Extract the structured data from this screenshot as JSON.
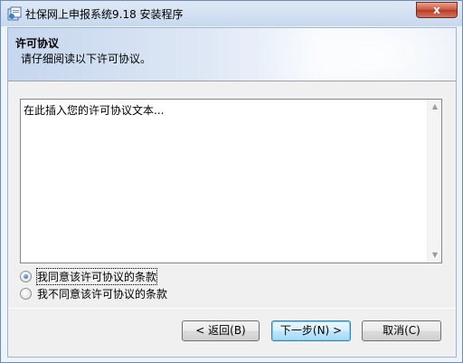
{
  "window": {
    "title": "社保网上申报系统9.18 安装程序",
    "close_label": "x"
  },
  "header": {
    "title": "许可协议",
    "subtitle": "请仔细阅读以下许可协议。"
  },
  "license": {
    "text": "在此插入您的许可协议文本..."
  },
  "scrollbar": {
    "up_icon": "▲",
    "down_icon": "▼"
  },
  "options": {
    "accept_label": "我同意该许可协议的条款",
    "decline_label": "我不同意该许可协议的条款",
    "selected": "accept"
  },
  "buttons": {
    "back_label": "< 返回(B)",
    "next_label": "下一步(N) >",
    "cancel_label": "取消(C)"
  },
  "colors": {
    "title_bar": "#c7d8ee",
    "close_button": "#c7533b",
    "accent": "#3c7fb1"
  }
}
